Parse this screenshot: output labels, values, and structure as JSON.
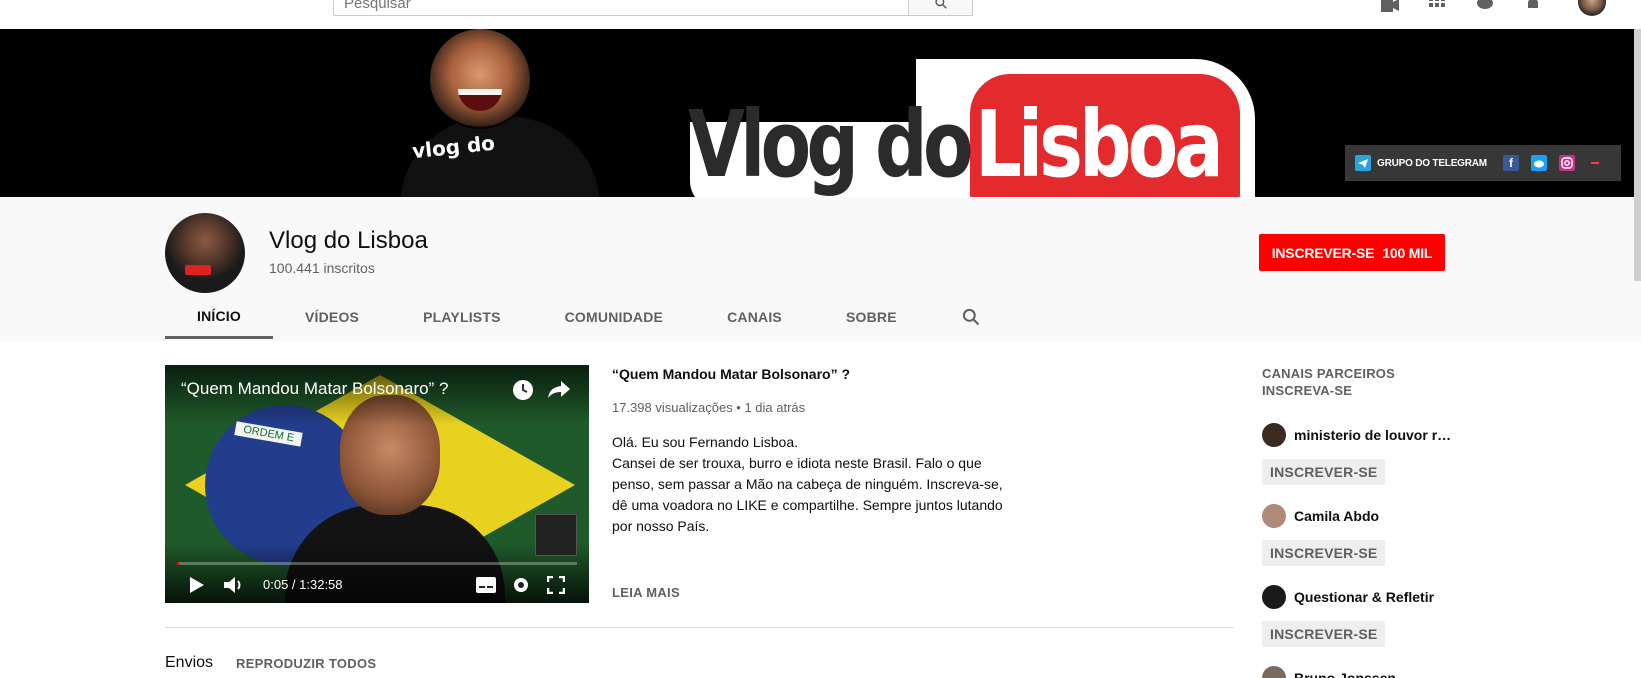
{
  "search": {
    "placeholder": "Pesquisar"
  },
  "banner": {
    "logo_part1": "Vlog do",
    "logo_part2": "Lisboa",
    "shirt_text": "vlog do",
    "telegram_label": "GRUPO DO TELEGRAM"
  },
  "channel": {
    "name": "Vlog do Lisboa",
    "subscribers": "100.441 inscritos",
    "subscribe_label": "INSCREVER-SE",
    "subscribe_count": "100 MIL"
  },
  "tabs": [
    "INÍCIO",
    "VÍDEOS",
    "PLAYLISTS",
    "COMUNIDADE",
    "CANAIS",
    "SOBRE"
  ],
  "featured": {
    "player_title": "“Quem Mandou Matar Bolsonaro” ?",
    "flag_band": "ORDEM E",
    "time": "0:05 / 1:32:58",
    "progress": 0.001,
    "title": "“Quem Mandou Matar Bolsonaro” ?",
    "meta": "17.398 visualizações • 1 dia atrás",
    "description": [
      "Olá. Eu sou Fernando Lisboa.",
      "Cansei de ser trouxa, burro e idiota neste Brasil. Falo o que",
      "penso, sem passar a Mão na cabeça de ninguém. Inscreva-se,",
      "dê uma voadora no LIKE e compartilhe. Sempre juntos lutando",
      "por nosso País."
    ],
    "read_more": "LEIA MAIS"
  },
  "shelf": {
    "title": "Envios",
    "play_all": "REPRODUZIR TODOS"
  },
  "sidebar": {
    "heading": "CANAIS PARCEIROS INSCREVA-SE",
    "partners": [
      {
        "name": "ministerio de louvor rai...",
        "button": "INSCREVER-SE",
        "color": "#3a2a22"
      },
      {
        "name": "Camila Abdo",
        "button": "INSCREVER-SE",
        "color": "#b08a78"
      },
      {
        "name": "Questionar & Refletir",
        "button": "INSCREVER-SE",
        "color": "#1a1a1a"
      },
      {
        "name": "Bruno Jonssen",
        "button": "",
        "color": "#7a6a60"
      }
    ]
  },
  "colors": {
    "brand_red": "#ff0000",
    "banner_bg": "#000000",
    "logo_red": "#e32a2d"
  }
}
